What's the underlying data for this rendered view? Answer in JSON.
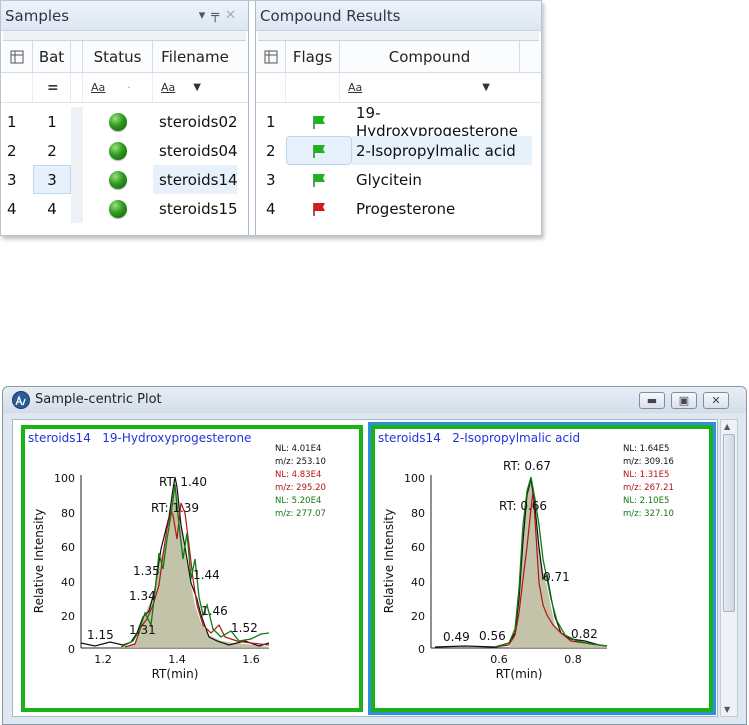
{
  "samples_pane": {
    "title": "Samples",
    "columns": [
      "Bat",
      "Status",
      "Filename"
    ],
    "filter": [
      "=",
      "Aa",
      "Aa"
    ],
    "rows": [
      {
        "n": "1",
        "bat": "1",
        "file": "steroids02"
      },
      {
        "n": "2",
        "bat": "2",
        "file": "steroids04"
      },
      {
        "n": "3",
        "bat": "3",
        "file": "steroids14"
      },
      {
        "n": "4",
        "bat": "4",
        "file": "steroids15"
      }
    ]
  },
  "compound_pane": {
    "title": "Compound Results",
    "columns": [
      "Flags",
      "Compound"
    ],
    "filter": [
      "Aa"
    ],
    "rows": [
      {
        "n": "1",
        "flag": "green",
        "compound": "19-Hydroxyprogesterone"
      },
      {
        "n": "2",
        "flag": "green",
        "compound": "2-Isopropylmalic acid"
      },
      {
        "n": "3",
        "flag": "green",
        "compound": "Glycitein"
      },
      {
        "n": "4",
        "flag": "red",
        "compound": "Progesterone"
      }
    ]
  },
  "plot_window": {
    "title": "Sample-centric Plot",
    "colors": {
      "black": "#111111",
      "red": "#b01515",
      "green": "#127a12",
      "fill": "#b8b89a",
      "frame": "#19b319"
    },
    "panels": [
      {
        "sample": "steroids14",
        "compound": "19-Hydroxyprogesterone",
        "nl": [
          {
            "l1": "NL: 4.01E4",
            "l2": "m/z: 253.10"
          },
          {
            "l1": "NL: 4.83E4",
            "l2": "m/z: 295.20"
          },
          {
            "l1": "NL: 5.20E4",
            "l2": "m/z: 277.07"
          }
        ],
        "ylabel": "Relative Intensity",
        "xlabel": "RT(min)",
        "yticks": [
          "100",
          "80",
          "60",
          "40",
          "20",
          "0"
        ],
        "xticks": [
          "1.2",
          "1.4",
          "1.6"
        ],
        "peak_labels": [
          "RT: 1.40",
          "RT: 1.39",
          "1.35",
          "1.44",
          "1.34",
          "1.46",
          "1.31",
          "1.52",
          "1.15"
        ]
      },
      {
        "sample": "steroids14",
        "compound": "2-Isopropylmalic acid",
        "nl": [
          {
            "l1": "NL: 1.64E5",
            "l2": "m/z: 309.16"
          },
          {
            "l1": "NL: 1.31E5",
            "l2": "m/z: 267.21"
          },
          {
            "l1": "NL: 2.10E5",
            "l2": "m/z: 327.10"
          }
        ],
        "ylabel": "Relative Intensity",
        "xlabel": "RT(min)",
        "yticks": [
          "100",
          "80",
          "60",
          "40",
          "20",
          "0"
        ],
        "xticks": [
          "0.6",
          "0.8"
        ],
        "peak_labels": [
          "RT: 0.67",
          "RT: 0.66",
          "0.71",
          "0.49",
          "0.56",
          "0.82"
        ]
      }
    ]
  }
}
